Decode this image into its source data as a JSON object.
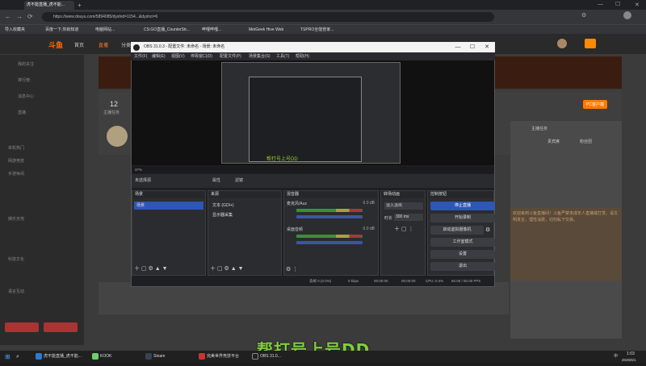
{
  "browser": {
    "tab_title": "虎不能直播_虎不能...",
    "url": "https://www.douyu.com/5894085/dyshid=1154...&dyshci=6",
    "bookmarks": [
      "导入收藏夹",
      "百度一下,你就知道",
      "电脑网站...",
      "CS:GO直播_CounterStr...",
      "哔哩哔哩...",
      "MetGeek Hive Web",
      "TSPRO全能管家..."
    ]
  },
  "site": {
    "logo": "斗鱼",
    "nav": [
      "首页",
      "直播",
      "分类"
    ],
    "sidebar": [
      "我的关注",
      "排行榜",
      "消息中心",
      "直播",
      "单机热门",
      "网游竞技",
      "手游休闲",
      "娱乐天地",
      "科技文化",
      "语言互动"
    ],
    "room_count": "12",
    "room_label": "主播任务",
    "chat_tabs": [
      "主播任务",
      "贵宾席",
      "粉丝团"
    ],
    "chat_notice": "欢迎来到斗鱼直播间！斗鱼严禁未成年人直播或打赏。请文明发言，理性消费，切勿私下交易。",
    "pc_button": "PC客户端"
  },
  "obs": {
    "title": "OBS 31.0.3 - 配置文件: 未命名 - 场景: 未命名",
    "menu": [
      "文件(F)",
      "编辑(E)",
      "视图(V)",
      "停靠窗口(D)",
      "配置文件(P)",
      "场景集合(S)",
      "工具(T)",
      "帮助(H)"
    ],
    "preview_caption": "帮打号上号DD",
    "zoom": "37%",
    "source_bar": {
      "label": "未选择源",
      "props": "属性",
      "filters": "滤镜"
    },
    "docks": {
      "scenes": {
        "title": "场景",
        "items": [
          "场景"
        ]
      },
      "sources": {
        "title": "来源",
        "items": [
          "文本 (GDI+)",
          "显示器采集"
        ]
      },
      "mixer": {
        "title": "混音器",
        "channels": [
          {
            "name": "麦克风/Aux",
            "db": "0.0 dB"
          },
          {
            "name": "桌面音频",
            "db": "0.0 dB"
          }
        ]
      },
      "transitions": {
        "title": "转场动画",
        "type": "淡入淡出",
        "duration_label": "时长",
        "duration": "300 ms"
      },
      "controls": {
        "title": "控制按钮",
        "buttons": [
          "停止直播",
          "开始录制",
          "启动虚拟摄像机",
          "工作室模式",
          "设置",
          "退出"
        ]
      }
    },
    "status": {
      "frames": "丢帧 0 (0.0%)",
      "kbps": "0 kbps",
      "stream_time": "00:00:00",
      "rec_time": "00:00:00",
      "cpu": "CPU: 0.4%",
      "fps": "60.00 / 60.00 FPS"
    }
  },
  "overlay_text": "帮打号上号DD",
  "taskbar": {
    "items": [
      "虎不能直播_虎不能...",
      "KOOK",
      "Steam",
      "完美世界竞技平台",
      "OBS 31.0..."
    ],
    "time": "1:03",
    "date": "2025/6/1",
    "lang": "中"
  },
  "colors": {
    "accent": "#2e56b5",
    "brand": "#ff6a00",
    "overlay": "#7fcf3a"
  }
}
